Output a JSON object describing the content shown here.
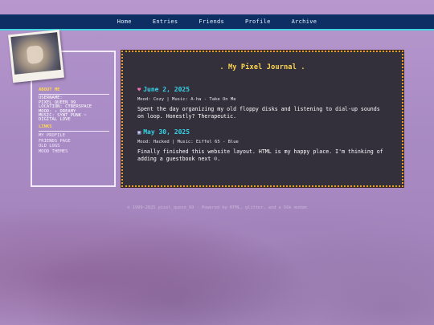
{
  "nav": {
    "items": [
      "Home",
      "Entries",
      "Friends",
      "Profile",
      "Archive"
    ]
  },
  "sidebar": {
    "about_heading": "ABOUT ME",
    "about_lines": [
      "USERNAME:",
      "PIXEL_QUEEN_99",
      "LOCATION: CYBERSPACE",
      "MOOD: ✧ DREAMY",
      "MUSIC: SYNT PUNK ~",
      "DIGITAL LOVE"
    ],
    "links_heading": "LINKS",
    "links": [
      "MY PROFILE",
      "FRIENDS PAGE",
      "OLD LOGS",
      "MOOD THEMES"
    ]
  },
  "journal": {
    "title": ". My Pixel Journal .",
    "entries": [
      {
        "icon": "heart-icon",
        "date": "June 2, 2025",
        "mood": "Mood: Cozy | Music: A-ha - Take On Me",
        "text": "Spent the day organizing my old floppy disks and listening to dial-up sounds on loop. Honestly? Therapeutic."
      },
      {
        "icon": "computer-icon",
        "date": "May 30, 2025",
        "mood": "Mood: Hacked | Music: Eiffel 65 - Blue",
        "text": "Finally finished this website layout. HTML is my happy place. I'm thinking of adding a guestbook next ☺."
      }
    ]
  },
  "footer": {
    "text": "© 1999-2025 pixel_queen_99 · Powered by HTML, glitter, and a 56k modem"
  },
  "colors": {
    "nav_bg": "#0e2f63",
    "nav_border": "#3fd6e0",
    "heading_yellow": "#ffd84d",
    "date_cyan": "#35d4e8",
    "journal_bg": "#33303c",
    "journal_border": "#e6a126"
  }
}
